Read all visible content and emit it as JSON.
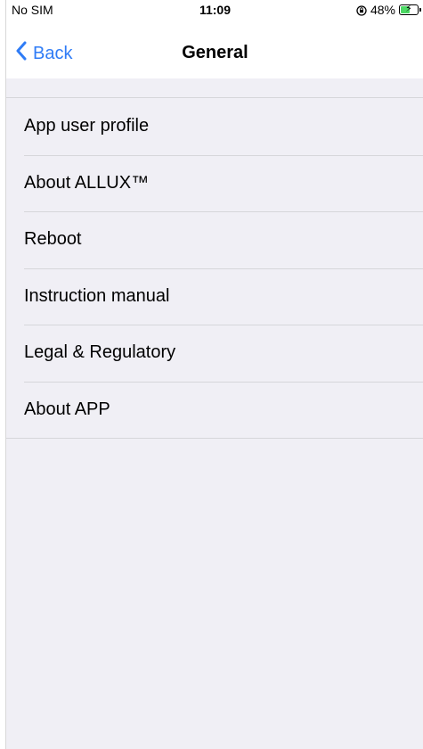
{
  "status_bar": {
    "carrier": "No SIM",
    "time": "11:09",
    "battery_percent": "48%",
    "battery_level": 0.48,
    "icons": [
      "rotation-lock-icon",
      "battery-charging-icon"
    ],
    "battery_color": "#4cd964"
  },
  "nav": {
    "back_label": "Back",
    "title": "General",
    "accent_color": "#2f7cf6"
  },
  "menu": {
    "items": [
      {
        "label": "App user profile"
      },
      {
        "label": "About ALLUX™"
      },
      {
        "label": "Reboot"
      },
      {
        "label": "Instruction manual"
      },
      {
        "label": "Legal & Regulatory"
      },
      {
        "label": "About APP"
      }
    ]
  }
}
